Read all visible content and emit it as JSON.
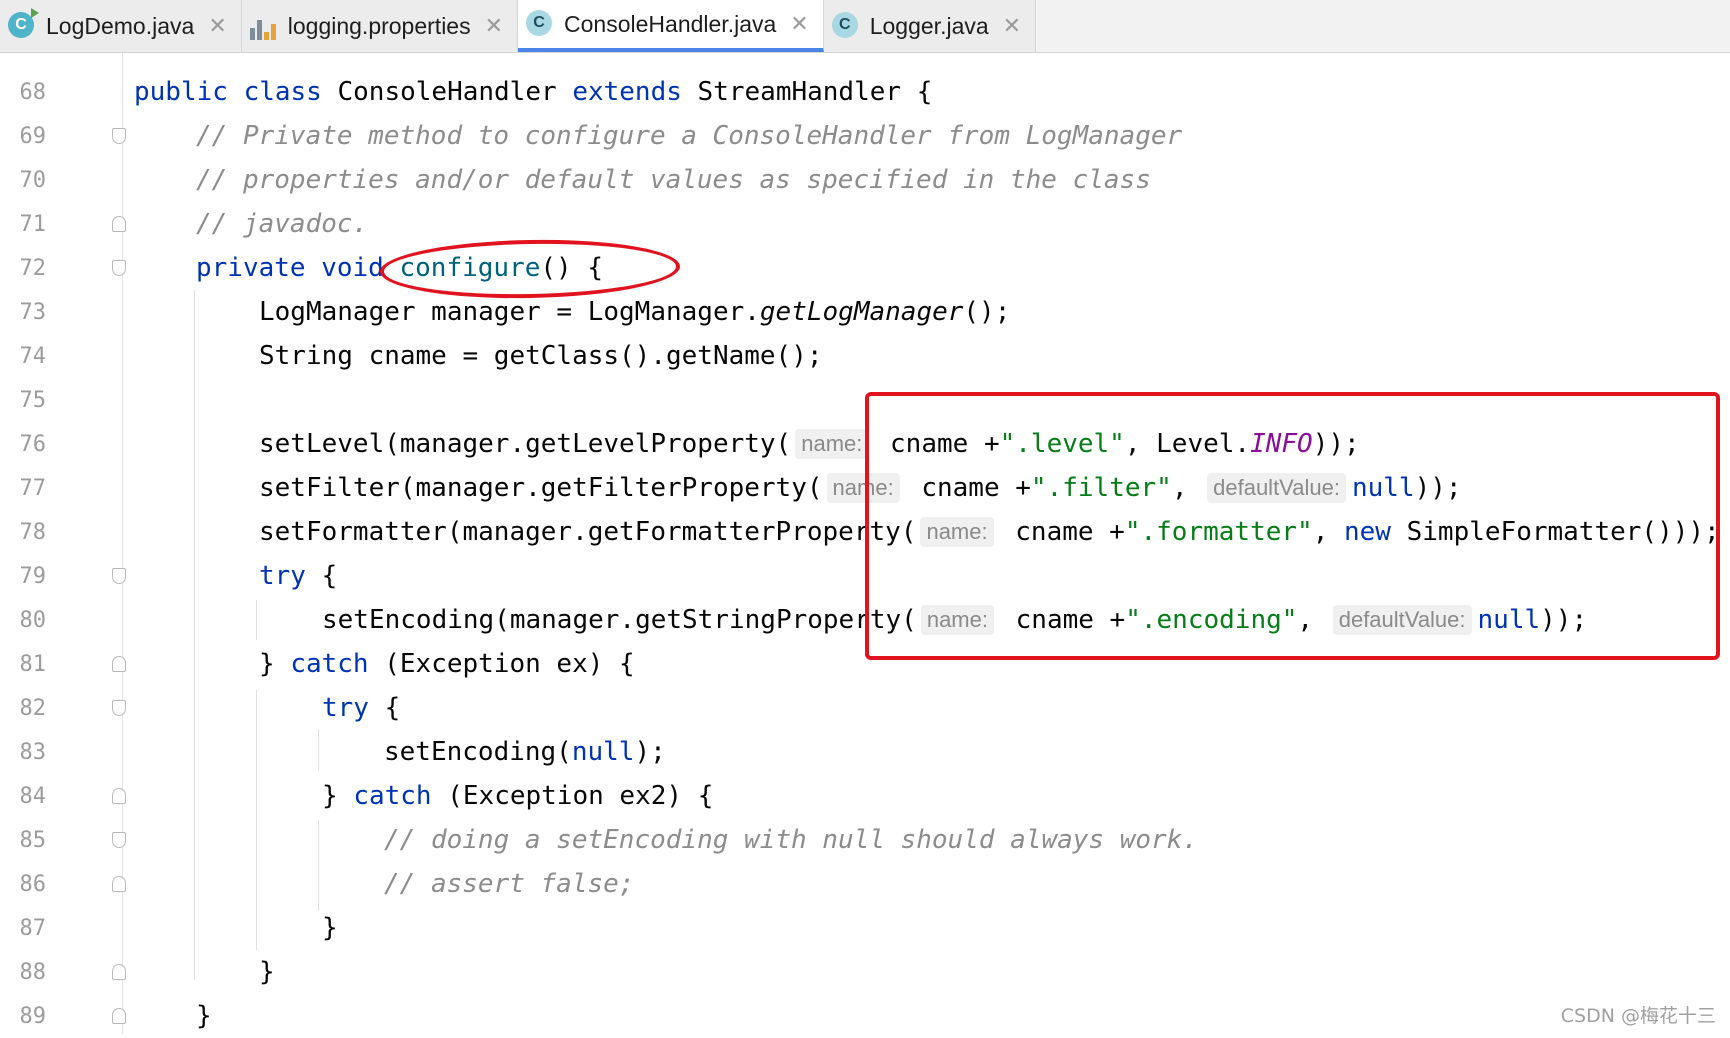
{
  "tabs": [
    {
      "label": "LogDemo.java",
      "icon": "java-class-run-icon",
      "active": false
    },
    {
      "label": "logging.properties",
      "icon": "properties-file-icon",
      "active": false
    },
    {
      "label": "ConsoleHandler.java",
      "icon": "java-class-icon",
      "active": true
    },
    {
      "label": "Logger.java",
      "icon": "java-class-icon",
      "active": false
    }
  ],
  "tab_close_glyph": "✕",
  "class_icon_letter": "C",
  "line_numbers": [
    "68",
    "69",
    "70",
    "71",
    "72",
    "73",
    "74",
    "75",
    "76",
    "77",
    "78",
    "79",
    "80",
    "81",
    "82",
    "83",
    "84",
    "85",
    "86",
    "87",
    "88",
    "89"
  ],
  "code": {
    "l68": {
      "kw1": "public class ",
      "cls": "ConsoleHandler ",
      "kw2": "extends ",
      "tail": "StreamHandler {"
    },
    "l69": {
      "cm": "// Private method to configure a ConsoleHandler from LogManager"
    },
    "l70": {
      "cm": "// properties and/or default values as specified in the class"
    },
    "l71": {
      "cm": "// javadoc."
    },
    "l72": {
      "kw": "private void ",
      "name": "configure",
      "tail": "() {"
    },
    "l73": {
      "a": "LogManager manager = LogManager.",
      "it": "getLogManager",
      "b": "();"
    },
    "l74": {
      "a": "String cname = getClass().getName();"
    },
    "l76": {
      "a": "setLevel(manager.getLevelProperty(",
      "hint": "name:",
      "b": " cname +",
      "str": "\".level\"",
      "c": ", Level.",
      "cst": "INFO",
      "d": "));"
    },
    "l77": {
      "a": "setFilter(manager.getFilterProperty(",
      "hint": "name:",
      "b": " cname +",
      "str": "\".filter\"",
      "c": ", ",
      "hint2": "defaultValue:",
      "kw": "null",
      "d": "));"
    },
    "l78": {
      "a": "setFormatter(manager.getFormatterProperty(",
      "hint": "name:",
      "b": " cname +",
      "str": "\".formatter\"",
      "c": ", ",
      "kw": "new ",
      "d": "SimpleFormatter()));"
    },
    "l79": {
      "kw": "try ",
      "tail": "{"
    },
    "l80": {
      "a": "setEncoding(manager.getStringProperty(",
      "hint": "name:",
      "b": " cname +",
      "str": "\".encoding\"",
      "c": ", ",
      "hint2": "defaultValue:",
      "kw": "null",
      "d": "));"
    },
    "l81": {
      "a": "} ",
      "kw": "catch ",
      "tail": "(Exception ex) {"
    },
    "l82": {
      "kw": "try ",
      "tail": "{"
    },
    "l83": {
      "a": "setEncoding(",
      "kw": "null",
      "tail": ");"
    },
    "l84": {
      "a": "} ",
      "kw": "catch ",
      "tail": "(Exception ex2) {"
    },
    "l85": {
      "cm": "// doing a setEncoding with null should always work."
    },
    "l86": {
      "cm": "// assert false;"
    },
    "l87": {
      "a": "}"
    },
    "l88": {
      "a": "}"
    },
    "l89": {
      "a": "}"
    }
  },
  "colors": {
    "keyword": "#0033b3",
    "comment": "#8c8c8c",
    "string": "#067d17",
    "constant": "#871094",
    "highlight": "#e0131f"
  },
  "watermark": "CSDN @梅花十三"
}
